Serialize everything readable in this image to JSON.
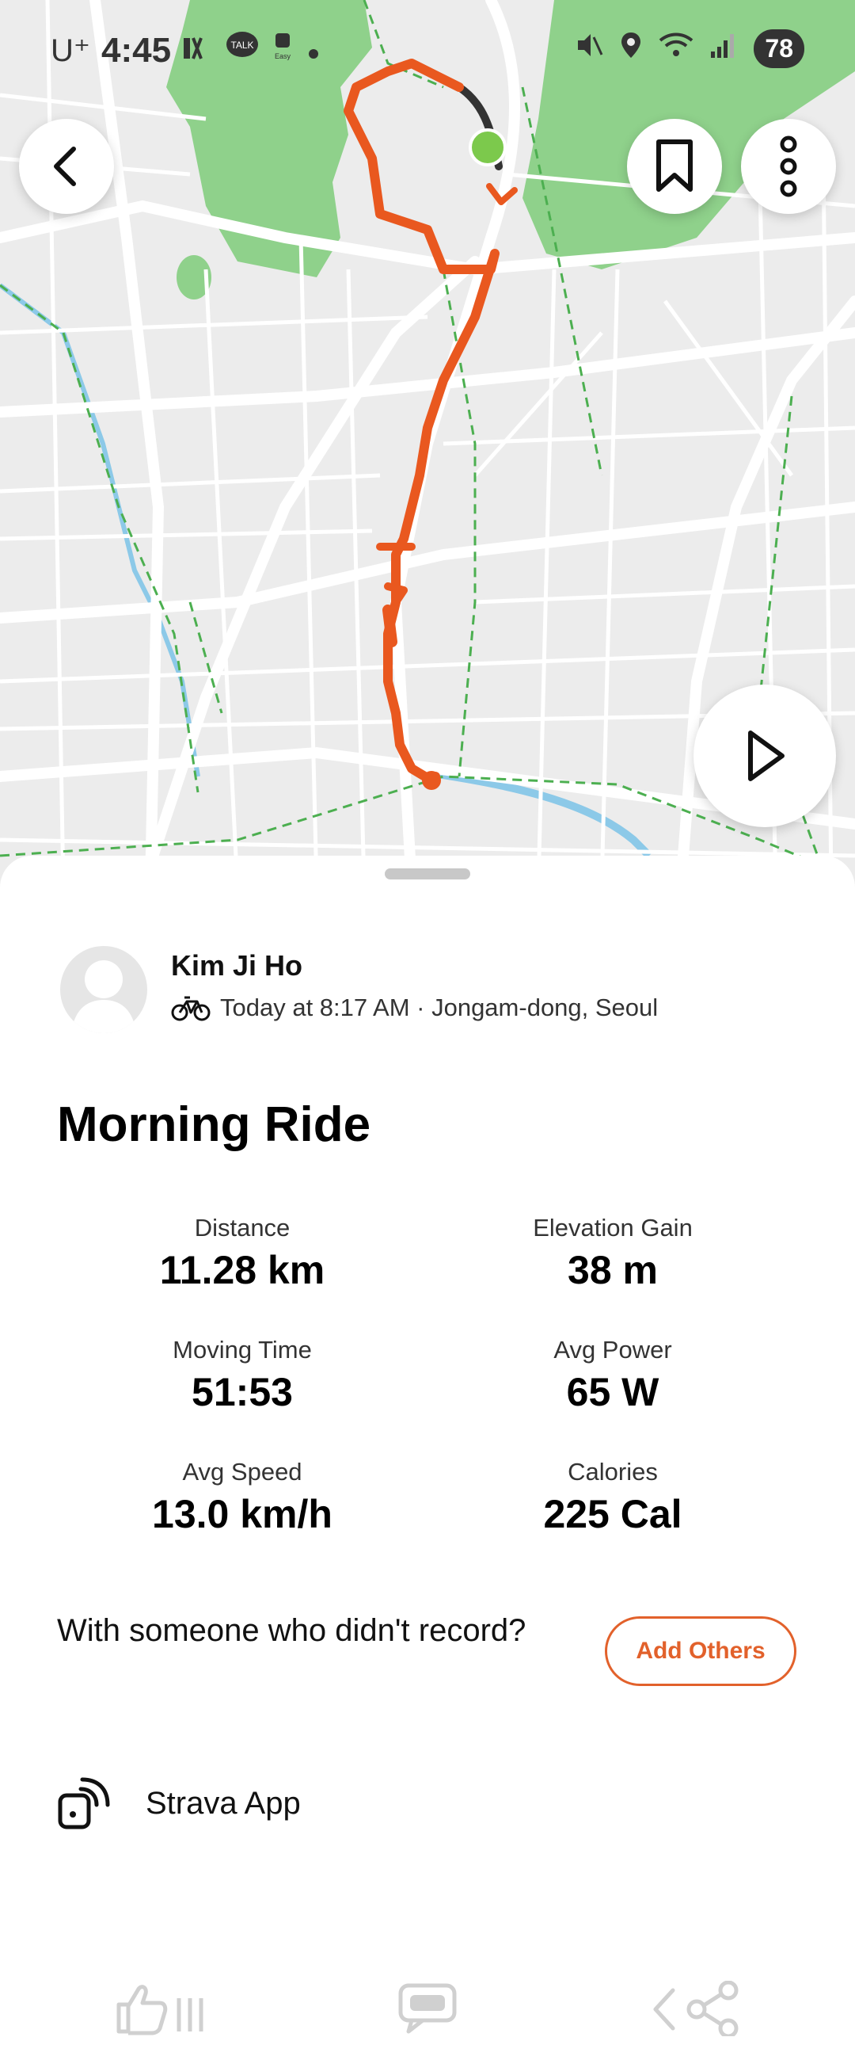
{
  "status_bar": {
    "carrier": "U⁺",
    "time": "4:45",
    "battery": "78",
    "icons": [
      "signal-1x-icon",
      "kakaotalk-icon",
      "easy-icon",
      "dot-icon",
      "mute-icon",
      "location-icon",
      "wifi-icon",
      "cell-signal-icon"
    ]
  },
  "map": {
    "route_color": "#e9581f",
    "park_color": "#8fd18b",
    "bike_path_color": "#4caf50",
    "water_color": "#8cc9e8",
    "end_marker_color": "#7cc94c"
  },
  "header_buttons": {
    "back": "back-arrow-icon",
    "save": "bookmark-icon",
    "more": "more-vertical-icon",
    "play": "play-icon"
  },
  "activity": {
    "athlete": "Kim Ji Ho",
    "sport_icon": "bicycle-icon",
    "meta": "Today at 8:17 AM · Jongam-dong, Seoul",
    "title": "Morning Ride"
  },
  "stats": [
    {
      "label": "Distance",
      "value": "11.28 km"
    },
    {
      "label": "Elevation Gain",
      "value": "38 m"
    },
    {
      "label": "Moving Time",
      "value": "51:53"
    },
    {
      "label": "Avg Power",
      "value": "65 W"
    },
    {
      "label": "Avg Speed",
      "value": "13.0 km/h"
    },
    {
      "label": "Calories",
      "value": "225 Cal"
    }
  ],
  "group": {
    "question": "With someone who didn't record?",
    "button": "Add Others"
  },
  "device": {
    "icon": "device-signal-icon",
    "name": "Strava App"
  },
  "accent_color": "#e2612b",
  "bottom_actions": [
    "kudos-thumbs-up-icon",
    "comment-icon",
    "share-icon"
  ]
}
